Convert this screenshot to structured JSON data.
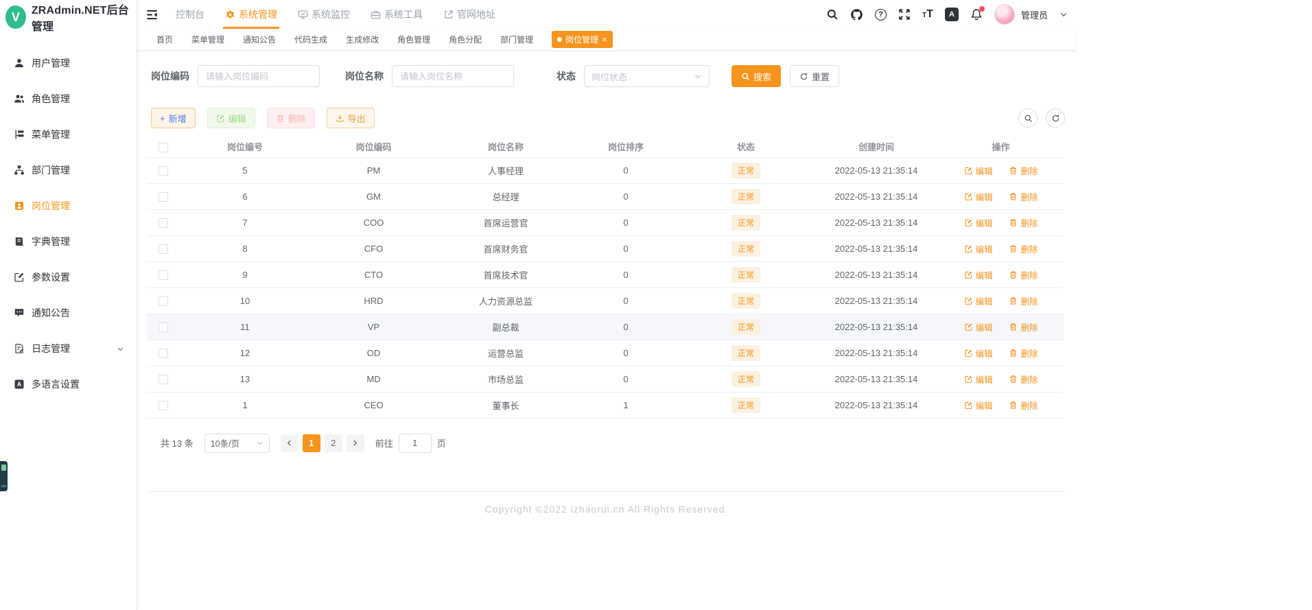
{
  "colors": {
    "accent": "#f7941d",
    "status_badge_bg": "#fcf0e0",
    "add_button_text": "#4f7df2",
    "disabled_green": "#a3da89",
    "disabled_red": "#f8b6b6",
    "export_orange": "#e6a23c",
    "notification_dot": "#ff4d4f",
    "logo_green": "#2fbe8a"
  },
  "sidebar": {
    "logo_letter": "V",
    "title": "ZRAdmin.NET后台管理",
    "items": [
      {
        "label": "用户管理",
        "icon": "user-icon"
      },
      {
        "label": "角色管理",
        "icon": "users-icon"
      },
      {
        "label": "菜单管理",
        "icon": "menu-tree-icon"
      },
      {
        "label": "部门管理",
        "icon": "org-chart-icon"
      },
      {
        "label": "岗位管理",
        "icon": "post-badge-icon",
        "active": true
      },
      {
        "label": "字典管理",
        "icon": "dictionary-icon"
      },
      {
        "label": "参数设置",
        "icon": "edit-square-icon"
      },
      {
        "label": "通知公告",
        "icon": "message-icon"
      },
      {
        "label": "日志管理",
        "icon": "log-icon",
        "has_submenu": true
      },
      {
        "label": "多语言设置",
        "icon": "language-icon"
      }
    ]
  },
  "topnav": {
    "items": [
      {
        "label": "控制台"
      },
      {
        "label": "系统管理",
        "icon": "gear-icon",
        "active": true
      },
      {
        "label": "系统监控",
        "icon": "monitor-icon"
      },
      {
        "label": "系统工具",
        "icon": "toolbox-icon"
      },
      {
        "label": "官网地址",
        "icon": "external-link-icon"
      }
    ],
    "header_icons": [
      "search-icon",
      "github-icon",
      "help-icon",
      "fullscreen-icon",
      "font-size-icon",
      "language-icon",
      "bell-icon"
    ],
    "user": {
      "name": "管理员"
    }
  },
  "tabs": [
    {
      "label": "首页"
    },
    {
      "label": "菜单管理"
    },
    {
      "label": "通知公告"
    },
    {
      "label": "代码生成"
    },
    {
      "label": "生成修改"
    },
    {
      "label": "角色管理"
    },
    {
      "label": "角色分配"
    },
    {
      "label": "部门管理"
    },
    {
      "label": "岗位管理",
      "active": true,
      "closable": true
    }
  ],
  "filters": {
    "code": {
      "label": "岗位编码",
      "placeholder": "请输入岗位编码",
      "value": ""
    },
    "name": {
      "label": "岗位名称",
      "placeholder": "请输入岗位名称",
      "value": ""
    },
    "status": {
      "label": "状态",
      "placeholder": "岗位状态"
    },
    "search_label": "搜索",
    "reset_label": "重置"
  },
  "toolbar": {
    "add_label": "新增",
    "edit_label": "编辑",
    "delete_label": "删除",
    "export_label": "导出"
  },
  "table": {
    "columns": [
      "岗位编号",
      "岗位编码",
      "岗位名称",
      "岗位排序",
      "状态",
      "创建时间",
      "操作"
    ],
    "action_labels": {
      "edit": "编辑",
      "delete": "删除"
    },
    "rows": [
      {
        "id": "5",
        "code": "PM",
        "name": "人事经理",
        "sort": "0",
        "status": "正常",
        "created": "2022-05-13 21:35:14"
      },
      {
        "id": "6",
        "code": "GM",
        "name": "总经理",
        "sort": "0",
        "status": "正常",
        "created": "2022-05-13 21:35:14"
      },
      {
        "id": "7",
        "code": "COO",
        "name": "首席运营官",
        "sort": "0",
        "status": "正常",
        "created": "2022-05-13 21:35:14"
      },
      {
        "id": "8",
        "code": "CFO",
        "name": "首席财务官",
        "sort": "0",
        "status": "正常",
        "created": "2022-05-13 21:35:14"
      },
      {
        "id": "9",
        "code": "CTO",
        "name": "首席技术官",
        "sort": "0",
        "status": "正常",
        "created": "2022-05-13 21:35:14"
      },
      {
        "id": "10",
        "code": "HRD",
        "name": "人力资源总监",
        "sort": "0",
        "status": "正常",
        "created": "2022-05-13 21:35:14"
      },
      {
        "id": "11",
        "code": "VP",
        "name": "副总裁",
        "sort": "0",
        "status": "正常",
        "created": "2022-05-13 21:35:14",
        "highlighted": true
      },
      {
        "id": "12",
        "code": "OD",
        "name": "运营总监",
        "sort": "0",
        "status": "正常",
        "created": "2022-05-13 21:35:14"
      },
      {
        "id": "13",
        "code": "MD",
        "name": "市场总监",
        "sort": "0",
        "status": "正常",
        "created": "2022-05-13 21:35:14"
      },
      {
        "id": "1",
        "code": "CEO",
        "name": "董事长",
        "sort": "1",
        "status": "正常",
        "created": "2022-05-13 21:35:14"
      }
    ]
  },
  "pagination": {
    "total_text": "共 13 条",
    "page_size": "10条/页",
    "pages": [
      {
        "label": "1",
        "active": true
      },
      {
        "label": "2"
      }
    ],
    "goto_label": "前往",
    "goto_value": "1",
    "page_label": "页"
  },
  "footer": {
    "copyright": "Copyright ©2022 izhaorui.cn All Rights Reserved."
  }
}
